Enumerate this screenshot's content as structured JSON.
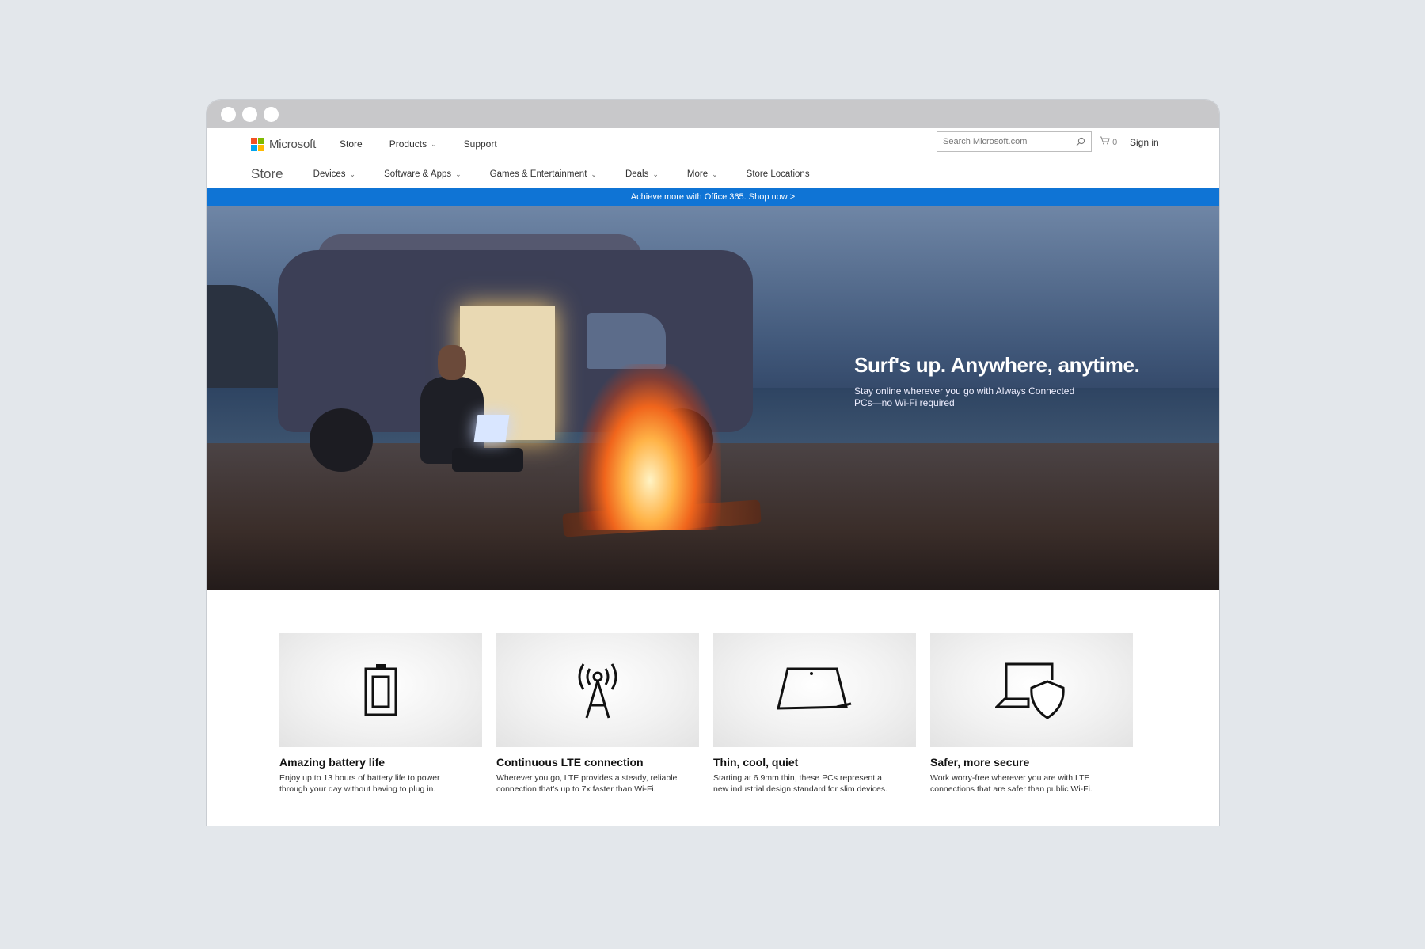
{
  "top_nav": {
    "logo_text": "Microsoft",
    "logo_colors": [
      "#f25022",
      "#7fba00",
      "#00a4ef",
      "#ffb900"
    ],
    "links": [
      {
        "label": "Store",
        "has_menu": false
      },
      {
        "label": "Products",
        "has_menu": true
      },
      {
        "label": "Support",
        "has_menu": false
      }
    ],
    "search_placeholder": "Search Microsoft.com",
    "cart_count": "0",
    "signin": "Sign in"
  },
  "store_nav": {
    "title": "Store",
    "links": [
      {
        "label": "Devices",
        "has_menu": true
      },
      {
        "label": "Software & Apps",
        "has_menu": true
      },
      {
        "label": "Games & Entertainment",
        "has_menu": true
      },
      {
        "label": "Deals",
        "has_menu": true
      },
      {
        "label": "More",
        "has_menu": true
      },
      {
        "label": "Store Locations",
        "has_menu": false
      }
    ]
  },
  "banner": {
    "text": "Achieve more with Office 365. Shop now >",
    "color": "#0f74d5"
  },
  "hero": {
    "title": "Surf's up. Anywhere, anytime.",
    "subtitle": "Stay online wherever you go with Always Connected PCs—no Wi-Fi required"
  },
  "features": [
    {
      "icon": "battery-icon",
      "title": "Amazing battery life",
      "text": "Enjoy up to 13 hours of battery life to power through your day without having to plug in."
    },
    {
      "icon": "antenna-icon",
      "title": "Continuous LTE connection",
      "text": "Wherever you go, LTE provides a steady, reliable connection that's up to 7x faster than Wi-Fi."
    },
    {
      "icon": "laptop-icon",
      "title": "Thin, cool, quiet",
      "text": "Starting at 6.9mm thin, these PCs represent a new industrial design standard for slim devices."
    },
    {
      "icon": "shield-laptop-icon",
      "title": "Safer, more secure",
      "text": "Work worry-free wherever you are with LTE connections that are safer than public Wi-Fi."
    }
  ]
}
